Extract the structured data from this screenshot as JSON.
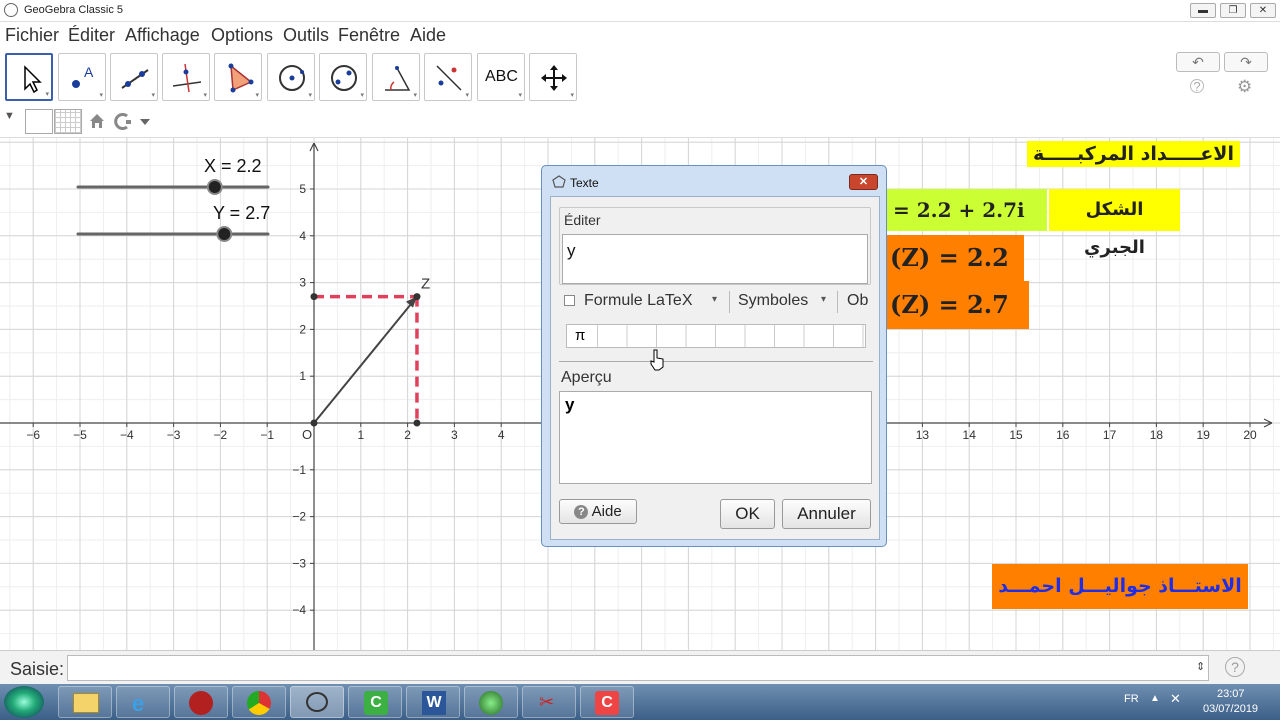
{
  "window": {
    "title": "GeoGebra Classic 5",
    "min": "▬",
    "max": "❐",
    "close": "✕"
  },
  "menu": [
    "Fichier",
    "Éditer",
    "Affichage",
    "Options",
    "Outils",
    "Fenêtre",
    "Aide"
  ],
  "toolbar": {
    "text_tool": "ABC",
    "undo": "↶",
    "redo": "↷",
    "help": "?",
    "settings": "⚙"
  },
  "sliders": [
    {
      "label": "X = 2.2",
      "value": 2.2
    },
    {
      "label": "Y = 2.7",
      "value": 2.7
    }
  ],
  "graph": {
    "origin_label": "O",
    "point_label": "Z",
    "x_ticks": [
      "−6",
      "−5",
      "−4",
      "−3",
      "−2",
      "−1",
      "1",
      "2",
      "3",
      "4",
      "13",
      "14",
      "15",
      "16",
      "17",
      "18",
      "19",
      "20"
    ],
    "y_ticks": [
      "5",
      "4",
      "3",
      "2",
      "1",
      "−1",
      "−2",
      "−3",
      "−4"
    ]
  },
  "colors": {
    "dashed": "#e0405c",
    "yellow": "#ffff00",
    "lime": "#ccff33",
    "orange": "#ff7f00",
    "blue_text": "#1f2ee6"
  },
  "boxes": {
    "title_ar": "الاعـــــداد المركبـــــة",
    "algebraic_label": "الشكل الجبري",
    "algebraic_formula": "= 2.2 + 2.7i",
    "re_formula": "(Z) = 2.2",
    "im_formula": "(Z) = 2.7",
    "author": "الاستـــاذ جواليـــل احمـــد"
  },
  "dialog": {
    "title": "Texte",
    "edit_label": "Éditer",
    "edit_value": "y",
    "latex_label": "Formule LaTeX",
    "symbols_label": "Symboles",
    "objects_label": "Ob",
    "pi": "π",
    "preview_label": "Aperçu",
    "preview_value": "y",
    "help_button": "Aide",
    "ok_button": "OK",
    "cancel_button": "Annuler"
  },
  "inputbar": {
    "label": "Saisie:"
  },
  "tray": {
    "lang": "FR",
    "time": "23:07",
    "date": "03/07/2019"
  }
}
